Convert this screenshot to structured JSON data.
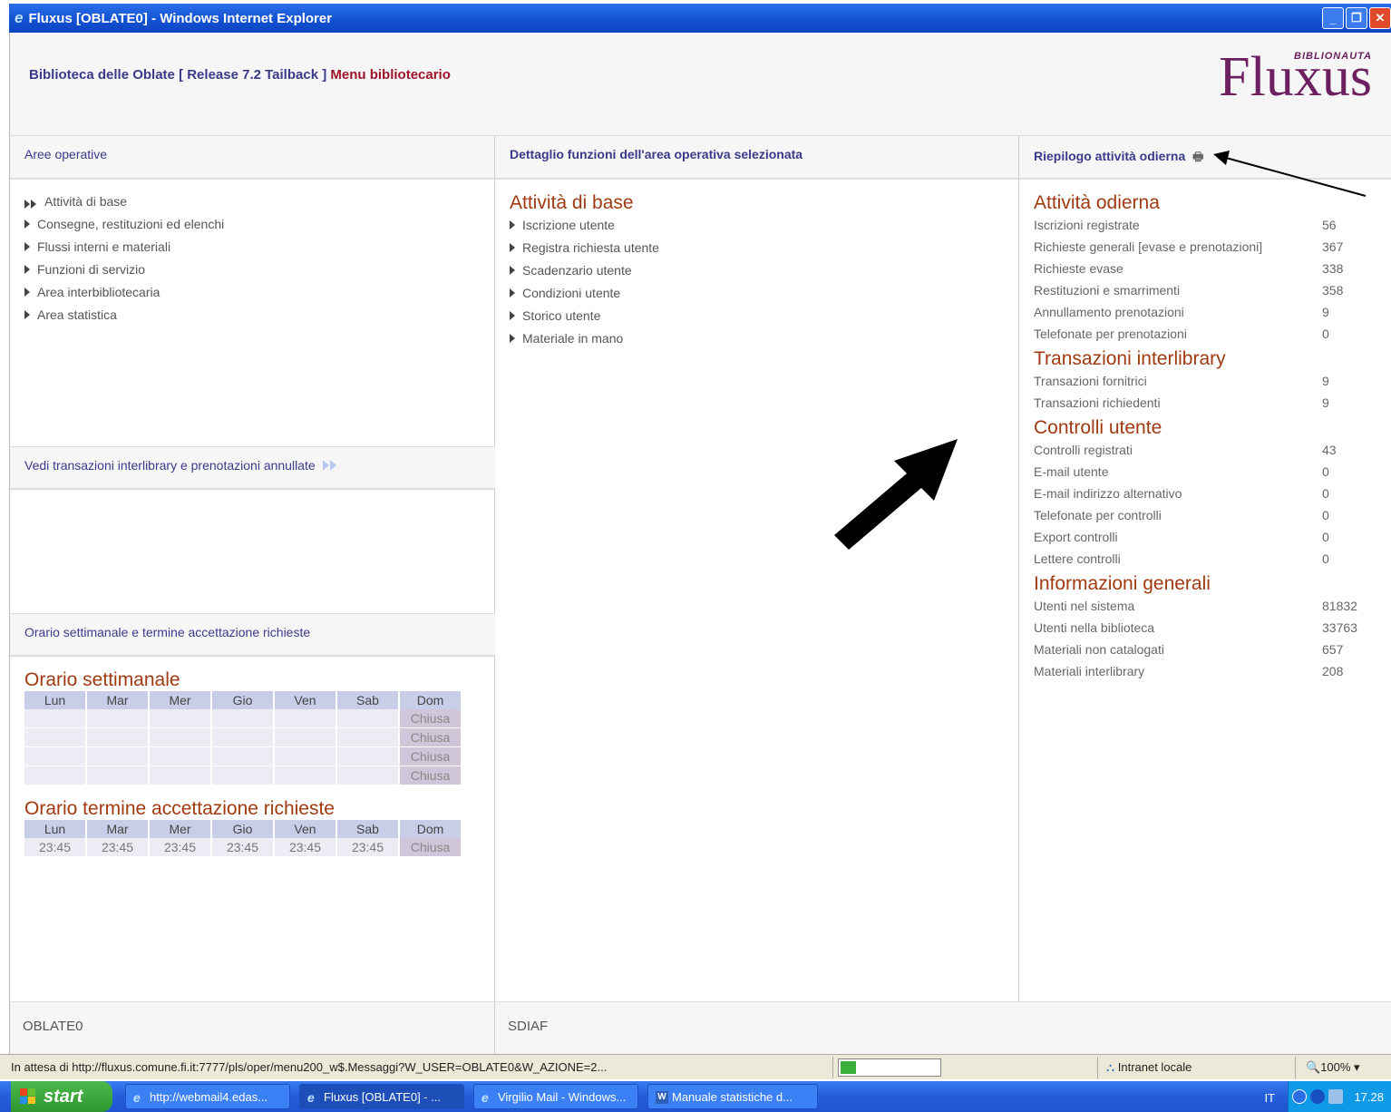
{
  "window": {
    "title": "Fluxus [OBLATE0] - Windows Internet Explorer"
  },
  "header": {
    "library": "Biblioteca delle Oblate",
    "release": "[ Release 7.2 Tailback ]",
    "menu": "Menu bibliotecario",
    "logo_text": "Fluxus",
    "logo_sub": "BIBLIONAUTA"
  },
  "left": {
    "title": "Aree operative",
    "items": [
      "Attività di base",
      "Consegne, restituzioni ed elenchi",
      "Flussi interni e materiali",
      "Funzioni di servizio",
      "Area interbibliotecaria",
      "Area statistica"
    ],
    "link": "Vedi transazioni interlibrary e prenotazioni annullate",
    "schedule_head": "Orario settimanale e termine accettazione richieste",
    "weekly_title": "Orario settimanale",
    "days": [
      "Lun",
      "Mar",
      "Mer",
      "Gio",
      "Ven",
      "Sab",
      "Dom"
    ],
    "weekly_rows": [
      [
        "",
        "",
        "",
        "",
        "",
        "",
        "Chiusa"
      ],
      [
        "",
        "",
        "",
        "",
        "",
        "",
        "Chiusa"
      ],
      [
        "",
        "",
        "",
        "",
        "",
        "",
        "Chiusa"
      ],
      [
        "",
        "",
        "",
        "",
        "",
        "",
        "Chiusa"
      ]
    ],
    "deadline_title": "Orario termine accettazione richieste",
    "deadline_row": [
      "23:45",
      "23:45",
      "23:45",
      "23:45",
      "23:45",
      "23:45",
      "Chiusa"
    ]
  },
  "middle": {
    "title": "Dettaglio funzioni dell'area operativa selezionata",
    "section": "Attività di base",
    "items": [
      "Iscrizione utente",
      "Registra richiesta utente",
      "Scadenzario utente",
      "Condizioni utente",
      "Storico utente",
      "Materiale in mano"
    ]
  },
  "right": {
    "title": "Riepilogo attività odierna",
    "groups": [
      {
        "title": "Attività odierna",
        "rows": [
          {
            "k": "Iscrizioni registrate",
            "v": "56"
          },
          {
            "k": "Richieste generali [evase e prenotazioni]",
            "v": "367"
          },
          {
            "k": "Richieste evase",
            "v": "338"
          },
          {
            "k": "Restituzioni e smarrimenti",
            "v": "358"
          },
          {
            "k": "Annullamento prenotazioni",
            "v": "9"
          },
          {
            "k": "Telefonate per prenotazioni",
            "v": "0"
          }
        ]
      },
      {
        "title": "Transazioni interlibrary",
        "rows": [
          {
            "k": "Transazioni fornitrici",
            "v": "9"
          },
          {
            "k": "Transazioni richiedenti",
            "v": "9"
          }
        ]
      },
      {
        "title": "Controlli utente",
        "rows": [
          {
            "k": "Controlli registrati",
            "v": "43"
          },
          {
            "k": "E-mail utente",
            "v": "0"
          },
          {
            "k": "E-mail indirizzo alternativo",
            "v": "0"
          },
          {
            "k": "Telefonate per controlli",
            "v": "0"
          },
          {
            "k": "Export controlli",
            "v": "0"
          },
          {
            "k": "Lettere controlli",
            "v": "0"
          }
        ]
      },
      {
        "title": "Informazioni generali",
        "rows": [
          {
            "k": "Utenti nel sistema",
            "v": "81832"
          },
          {
            "k": "Utenti nella biblioteca",
            "v": "33763"
          },
          {
            "k": "Materiali non catalogati",
            "v": "657"
          },
          {
            "k": "Materiali interlibrary",
            "v": "208"
          }
        ]
      }
    ]
  },
  "footer": {
    "left": "OBLATE0",
    "middle": "SDIAF"
  },
  "statusbar": {
    "message": "In attesa di http://fluxus.comune.fi.it:7777/pls/oper/menu200_w$.Messaggi?W_USER=OBLATE0&W_AZIONE=2...",
    "progress": 0.16,
    "zone": "Intranet locale",
    "zoom": "100%"
  },
  "taskbar": {
    "start": "start",
    "tasks": [
      "http://webmail4.edas...",
      "Fluxus [OBLATE0] - ...",
      "Virgilio Mail - Windows...",
      "Manuale statistiche d..."
    ],
    "lang": "IT",
    "time": "17.28"
  }
}
